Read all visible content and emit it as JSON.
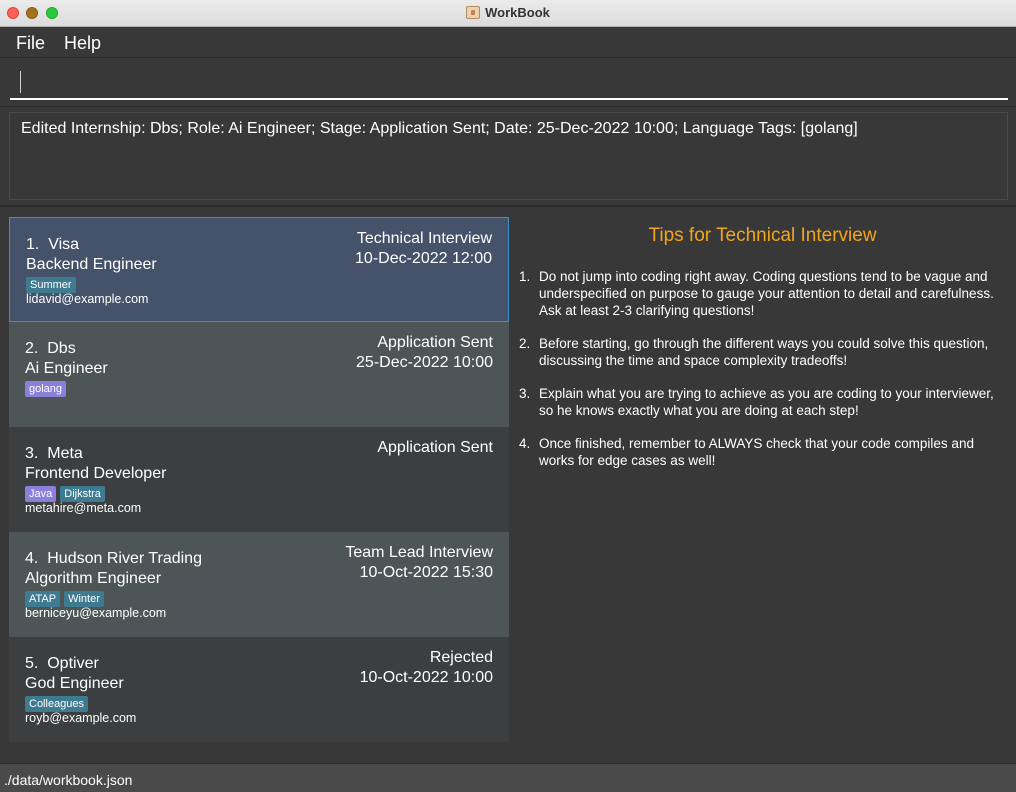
{
  "window": {
    "title": "WorkBook"
  },
  "menu": {
    "file": "File",
    "help": "Help"
  },
  "command": {
    "value": "",
    "placeholder": ""
  },
  "result": {
    "text": "Edited Internship: Dbs; Role: Ai Engineer; Stage: Application Sent; Date: 25-Dec-2022 10:00; Language Tags: [golang]"
  },
  "internships": [
    {
      "index": "1.",
      "company": "Visa",
      "role": "Backend Engineer",
      "tags": [
        {
          "label": "Summer",
          "kind": "blue"
        }
      ],
      "email": "lidavid@example.com",
      "stage": "Technical Interview",
      "date": "10-Dec-2022 12:00",
      "selected": true
    },
    {
      "index": "2.",
      "company": "Dbs",
      "role": "Ai Engineer",
      "tags": [
        {
          "label": "golang",
          "kind": "purple"
        }
      ],
      "email": "",
      "stage": "Application Sent",
      "date": "25-Dec-2022 10:00",
      "selected": false
    },
    {
      "index": "3.",
      "company": "Meta",
      "role": "Frontend Developer",
      "tags": [
        {
          "label": "Java",
          "kind": "purple"
        },
        {
          "label": "Dijkstra",
          "kind": "blue"
        }
      ],
      "email": "metahire@meta.com",
      "stage": "Application Sent",
      "date": "",
      "selected": false
    },
    {
      "index": "4.",
      "company": "Hudson River Trading",
      "role": "Algorithm Engineer",
      "tags": [
        {
          "label": "ATAP",
          "kind": "blue"
        },
        {
          "label": "Winter",
          "kind": "blue"
        }
      ],
      "email": "berniceyu@example.com",
      "stage": "Team Lead Interview",
      "date": "10-Oct-2022 15:30",
      "selected": false
    },
    {
      "index": "5.",
      "company": "Optiver",
      "role": "God Engineer",
      "tags": [
        {
          "label": "Colleagues",
          "kind": "blue"
        }
      ],
      "email": "royb@example.com",
      "stage": "Rejected",
      "date": "10-Oct-2022 10:00",
      "selected": false
    }
  ],
  "tips": {
    "title": "Tips for Technical Interview",
    "items": [
      {
        "num": "1.",
        "text": "Do not jump into coding right away. Coding questions tend to be vague and underspecified on purpose to gauge your attention to detail and carefulness. Ask at least 2-3 clarifying questions!"
      },
      {
        "num": "2.",
        "text": "Before starting, go through the different ways you could solve this question, discussing the time and space complexity tradeoffs!"
      },
      {
        "num": "3.",
        "text": "Explain what you are trying to achieve as you are coding to your interviewer, so he knows exactly what you are doing at each step!"
      },
      {
        "num": "4.",
        "text": "Once finished, remember to ALWAYS check that your code compiles and works for edge cases as well!"
      }
    ]
  },
  "status": {
    "path": "./data/workbook.json"
  },
  "colors": {
    "accent": "#f2a51a",
    "selection_border": "#3e8fc5",
    "tag_blue": "#3e7b91",
    "tag_purple": "#8a7fd9"
  }
}
